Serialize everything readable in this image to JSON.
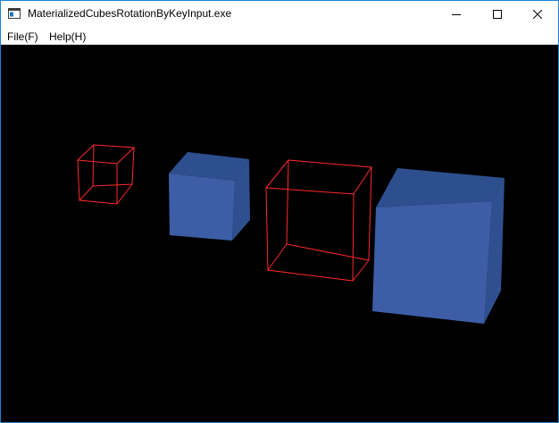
{
  "window": {
    "title": "MaterializedCubesRotationByKeyInput.exe",
    "icon": "app-window-icon"
  },
  "menu": {
    "items": [
      {
        "label": "File(F)"
      },
      {
        "label": "Help(H)"
      }
    ]
  },
  "caption_buttons": {
    "minimize": "minimize-icon",
    "maximize": "maximize-icon",
    "close": "close-icon"
  },
  "scene": {
    "background": "#000000",
    "wireframe_color": "#ff2a2a",
    "solid_face_colors": {
      "front": "#3d5ea6",
      "top": "#2d4f8e",
      "side": "#2f4f91"
    },
    "cubes": [
      {
        "kind": "wireframe"
      },
      {
        "kind": "solid"
      },
      {
        "kind": "wireframe"
      },
      {
        "kind": "solid"
      }
    ]
  }
}
